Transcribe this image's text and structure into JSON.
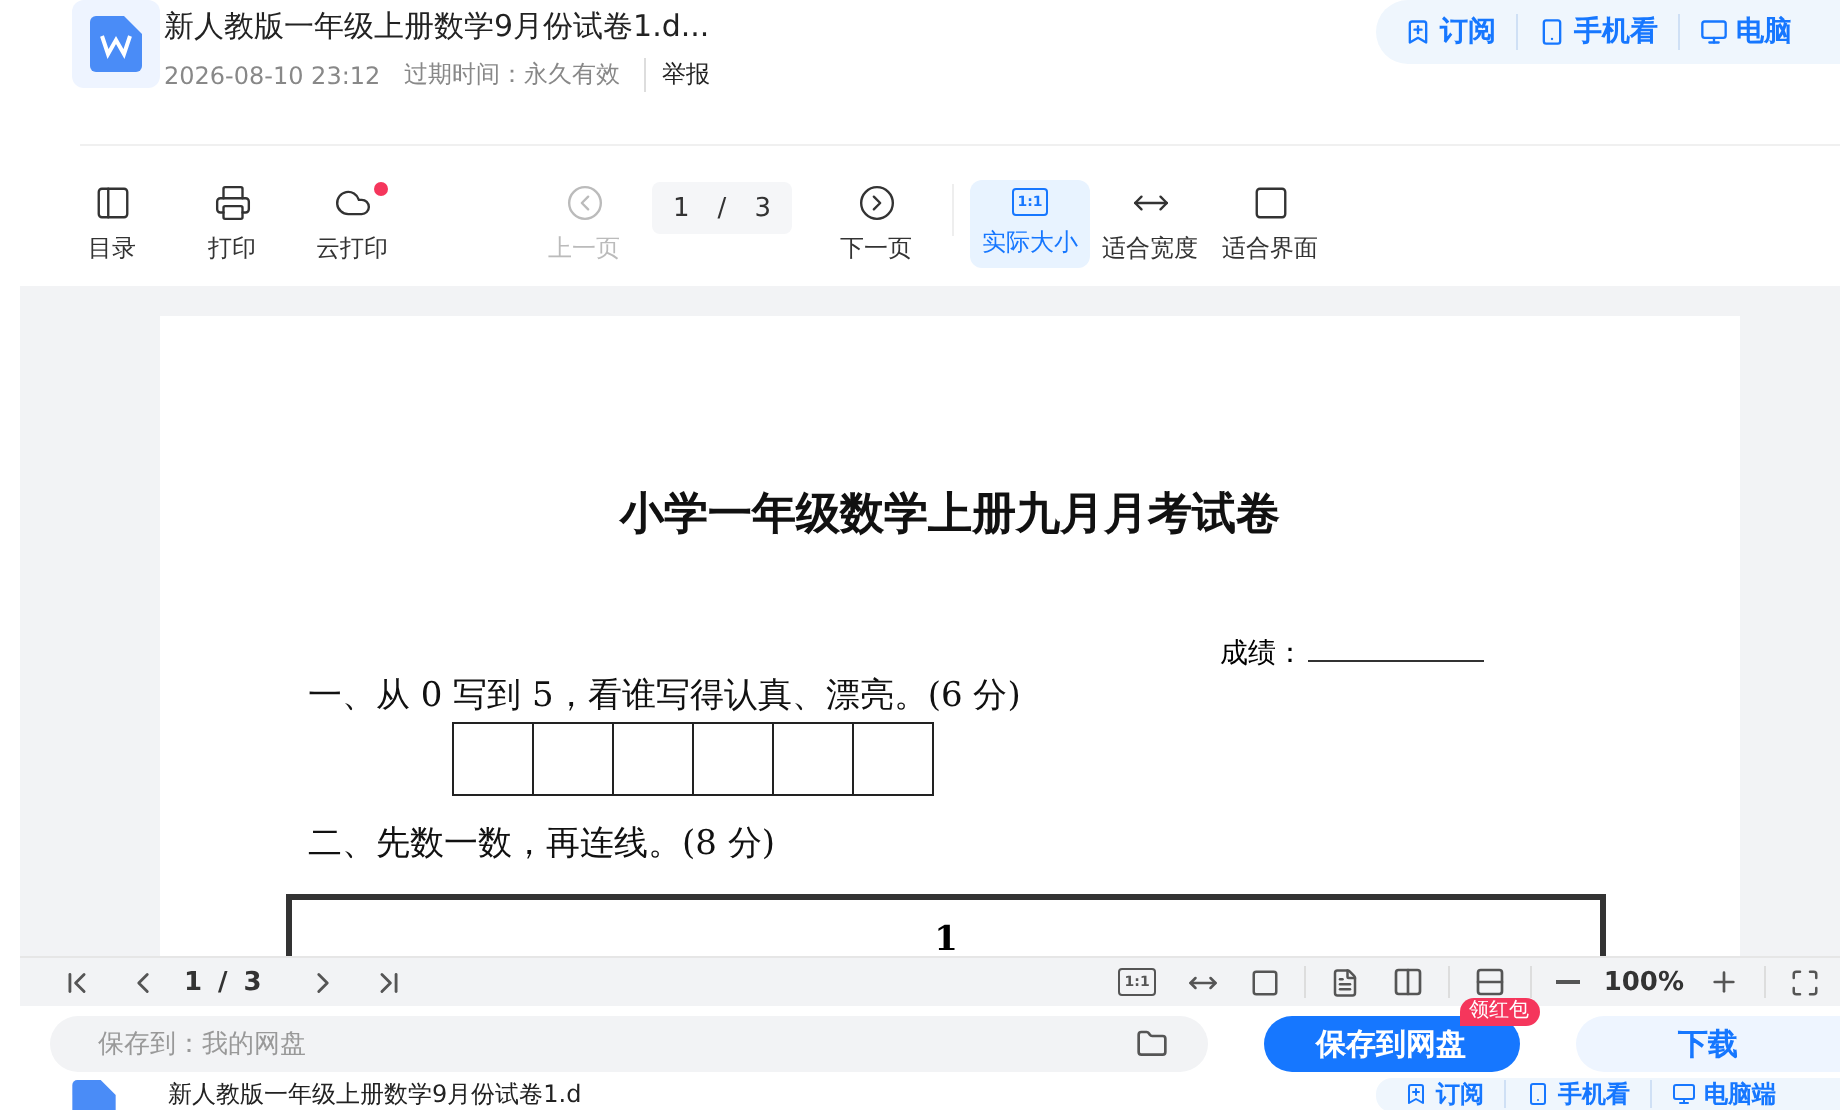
{
  "header": {
    "title": "新人教版一年级上册数学9月份试卷1.d...",
    "date": "2026-08-10 23:12",
    "expiry": "过期时间：永久有效",
    "report": "举报",
    "actions": [
      "订阅",
      "手机看",
      "电脑"
    ]
  },
  "toolbar": [
    {
      "kind": "toc",
      "label": "目录",
      "disabled": false,
      "badge": false,
      "selected": false
    },
    {
      "kind": "print",
      "label": "打印",
      "disabled": false,
      "badge": false,
      "selected": false
    },
    {
      "kind": "cloud",
      "label": "云打印",
      "disabled": false,
      "badge": true,
      "selected": false
    },
    {
      "kind": "prev",
      "label": "上一页",
      "disabled": true,
      "badge": false,
      "selected": false
    },
    {
      "kind": "pager",
      "current": "1",
      "sep": "/",
      "total": "3"
    },
    {
      "kind": "next",
      "label": "下一页",
      "disabled": false,
      "badge": false,
      "selected": false
    },
    {
      "kind": "actual",
      "label": "实际大小",
      "icon_text": "1:1",
      "disabled": false,
      "badge": false,
      "selected": true
    },
    {
      "kind": "fitwidth",
      "label": "适合宽度",
      "disabled": false,
      "badge": false,
      "selected": false
    },
    {
      "kind": "fitpage",
      "label": "适合界面",
      "disabled": false,
      "badge": false,
      "selected": false
    }
  ],
  "document": {
    "title": "小学一年级数学上册九月月考试卷",
    "score_label": "成绩：",
    "questions": [
      "一、从 0 写到 5，看谁写得认真、漂亮。(6 分)",
      "二、先数一数，再连线。(8 分)"
    ],
    "figure_label": "1"
  },
  "viewer_bar": {
    "current": "1",
    "sep": "/",
    "total": "3",
    "actual_icon": "1:1",
    "zoom": "100%"
  },
  "save_bar": {
    "location": "保存到：我的网盘",
    "save_button": "保存到网盘",
    "badge": "领红包",
    "download": "下载"
  },
  "sticky_header": {
    "title": "新人教版一年级上册数学9月份试卷1.d",
    "actions": [
      "订阅",
      "手机看",
      "电脑端"
    ]
  }
}
